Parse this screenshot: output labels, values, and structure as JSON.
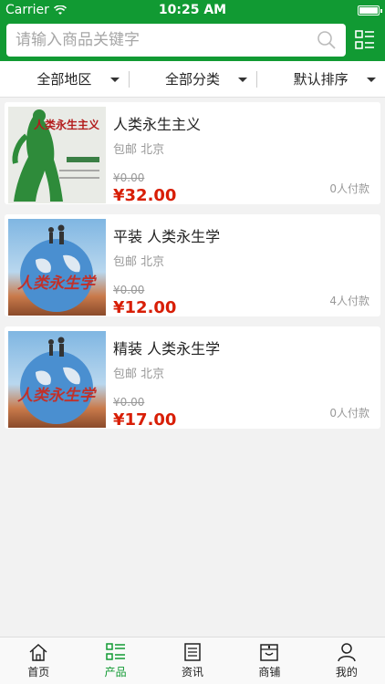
{
  "status": {
    "carrier": "Carrier",
    "time": "10:25 AM"
  },
  "search": {
    "placeholder": "请输入商品关键字"
  },
  "filters": [
    "全部地区",
    "全部分类",
    "默认排序"
  ],
  "products": [
    {
      "title": "人类永生主义",
      "meta": "包邮 北京",
      "old_price": "¥0.00",
      "price": "¥32.00",
      "sold": "0人付款",
      "cover_text": "人类永生主义"
    },
    {
      "title": "平装 人类永生学",
      "meta": "包邮 北京",
      "old_price": "¥0.00",
      "price": "¥12.00",
      "sold": "4人付款",
      "cover_text": "人类永生学"
    },
    {
      "title": "精装 人类永生学",
      "meta": "包邮 北京",
      "old_price": "¥0.00",
      "price": "¥17.00",
      "sold": "0人付款",
      "cover_text": "人类永生学"
    }
  ],
  "tabs": [
    {
      "label": "首页",
      "icon": "home-icon"
    },
    {
      "label": "产品",
      "icon": "list-icon"
    },
    {
      "label": "资讯",
      "icon": "news-icon"
    },
    {
      "label": "商铺",
      "icon": "shop-icon"
    },
    {
      "label": "我的",
      "icon": "user-icon"
    }
  ],
  "colors": {
    "brand": "#119a33",
    "price": "#d81e06"
  }
}
